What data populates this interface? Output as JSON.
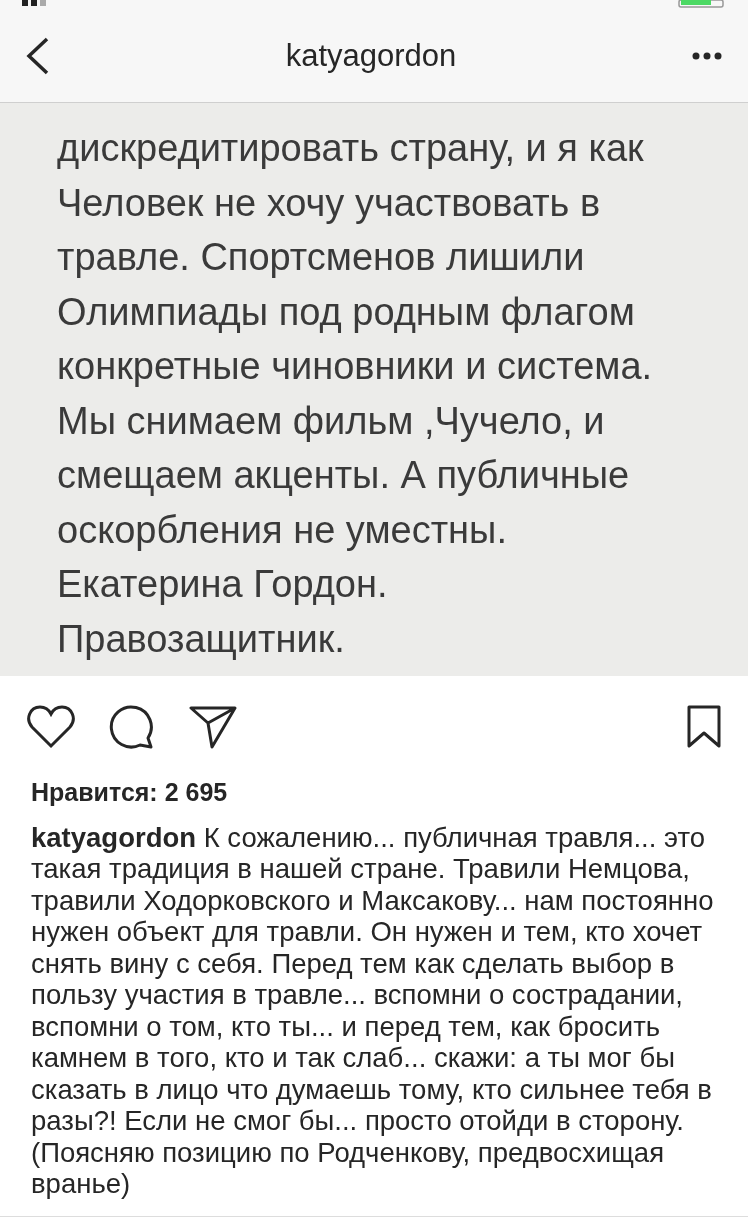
{
  "header": {
    "title": "katyagordon"
  },
  "post_image": {
    "lines": [
      "дискредитировать страну, и я как",
      "Человек не хочу участвовать в",
      "травле. Спортсменов лишили",
      "Олимпиады под родным флагом",
      "конкретные чиновники и система.",
      "Мы снимаем фильм ,Чучело, и",
      "смещаем акценты. А публичные",
      "оскорбления не уместны.",
      "Екатерина Гордон.",
      "Правозащитник."
    ]
  },
  "likes": "Нравится: 2 695",
  "caption": "**katyagordon** К сожалению... публичная травля... это такая традиция в нашей стране. Травили Немцова, травили Ходорковского и Максакову... нам постоянно нужен объект для травли. Он нужен и тем, кто хочет снять вину с себя. Перед тем как сделать выбор в пользу участия в травле... вспомни о сострадании, вспомни о том, кто ты... и перед тем, как бросить камнем в того, кто и так слаб... скажи: а ты мог бы сказать в лицо что думаешь тому, кто сильнее тебя в разы?! Если не смог бы... просто отойди в сторону. (Поясняю позицию по Родченкову, предвосхищая вранье)"
}
